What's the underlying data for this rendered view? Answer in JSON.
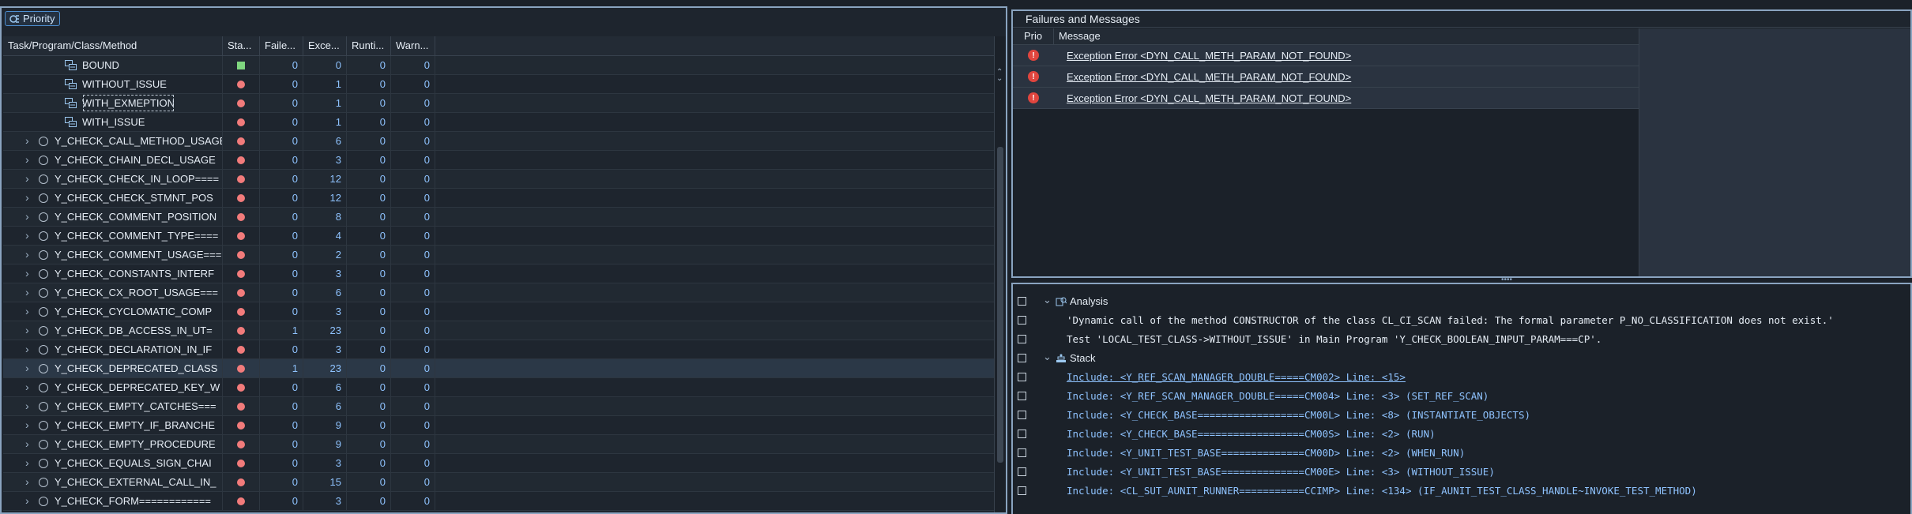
{
  "toolbar": {
    "priority_label": "Priority"
  },
  "task_table": {
    "columns": [
      "Task/Program/Class/Method",
      "Sta...",
      "Faile...",
      "Exce...",
      "Runti...",
      "Warn..."
    ],
    "rows": [
      {
        "name": "BOUND",
        "child": true,
        "status": "green",
        "failed": "0",
        "exceptions": "0",
        "runtime": "0",
        "warnings": "0"
      },
      {
        "name": "WITHOUT_ISSUE",
        "child": true,
        "status": "red",
        "failed": "0",
        "exceptions": "1",
        "runtime": "0",
        "warnings": "0"
      },
      {
        "name": "WITH_EXMEPTION",
        "child": true,
        "status": "red",
        "failed": "0",
        "exceptions": "1",
        "runtime": "0",
        "warnings": "0",
        "focused": true
      },
      {
        "name": "WITH_ISSUE",
        "child": true,
        "status": "red",
        "failed": "0",
        "exceptions": "1",
        "runtime": "0",
        "warnings": "0"
      },
      {
        "name": "Y_CHECK_CALL_METHOD_USAGE",
        "child": false,
        "status": "red",
        "failed": "0",
        "exceptions": "6",
        "runtime": "0",
        "warnings": "0"
      },
      {
        "name": "Y_CHECK_CHAIN_DECL_USAGE",
        "child": false,
        "status": "red",
        "failed": "0",
        "exceptions": "3",
        "runtime": "0",
        "warnings": "0"
      },
      {
        "name": "Y_CHECK_CHECK_IN_LOOP====",
        "child": false,
        "status": "red",
        "failed": "0",
        "exceptions": "12",
        "runtime": "0",
        "warnings": "0"
      },
      {
        "name": "Y_CHECK_CHECK_STMNT_POS",
        "child": false,
        "status": "red",
        "failed": "0",
        "exceptions": "12",
        "runtime": "0",
        "warnings": "0"
      },
      {
        "name": "Y_CHECK_COMMENT_POSITION",
        "child": false,
        "status": "red",
        "failed": "0",
        "exceptions": "8",
        "runtime": "0",
        "warnings": "0"
      },
      {
        "name": "Y_CHECK_COMMENT_TYPE====",
        "child": false,
        "status": "red",
        "failed": "0",
        "exceptions": "4",
        "runtime": "0",
        "warnings": "0"
      },
      {
        "name": "Y_CHECK_COMMENT_USAGE===",
        "child": false,
        "status": "red",
        "failed": "0",
        "exceptions": "2",
        "runtime": "0",
        "warnings": "0"
      },
      {
        "name": "Y_CHECK_CONSTANTS_INTERF",
        "child": false,
        "status": "red",
        "failed": "0",
        "exceptions": "3",
        "runtime": "0",
        "warnings": "0"
      },
      {
        "name": "Y_CHECK_CX_ROOT_USAGE===",
        "child": false,
        "status": "red",
        "failed": "0",
        "exceptions": "6",
        "runtime": "0",
        "warnings": "0"
      },
      {
        "name": "Y_CHECK_CYCLOMATIC_COMP",
        "child": false,
        "status": "red",
        "failed": "0",
        "exceptions": "3",
        "runtime": "0",
        "warnings": "0"
      },
      {
        "name": "Y_CHECK_DB_ACCESS_IN_UT=",
        "child": false,
        "status": "red",
        "failed": "1",
        "exceptions": "23",
        "runtime": "0",
        "warnings": "0"
      },
      {
        "name": "Y_CHECK_DECLARATION_IN_IF",
        "child": false,
        "status": "red",
        "failed": "0",
        "exceptions": "3",
        "runtime": "0",
        "warnings": "0"
      },
      {
        "name": "Y_CHECK_DEPRECATED_CLASS",
        "child": false,
        "status": "red",
        "failed": "1",
        "exceptions": "23",
        "runtime": "0",
        "warnings": "0",
        "selected": true
      },
      {
        "name": "Y_CHECK_DEPRECATED_KEY_W",
        "child": false,
        "status": "red",
        "failed": "0",
        "exceptions": "6",
        "runtime": "0",
        "warnings": "0"
      },
      {
        "name": "Y_CHECK_EMPTY_CATCHES===",
        "child": false,
        "status": "red",
        "failed": "0",
        "exceptions": "6",
        "runtime": "0",
        "warnings": "0"
      },
      {
        "name": "Y_CHECK_EMPTY_IF_BRANCHE",
        "child": false,
        "status": "red",
        "failed": "0",
        "exceptions": "9",
        "runtime": "0",
        "warnings": "0"
      },
      {
        "name": "Y_CHECK_EMPTY_PROCEDURE",
        "child": false,
        "status": "red",
        "failed": "0",
        "exceptions": "9",
        "runtime": "0",
        "warnings": "0"
      },
      {
        "name": "Y_CHECK_EQUALS_SIGN_CHAI",
        "child": false,
        "status": "red",
        "failed": "0",
        "exceptions": "3",
        "runtime": "0",
        "warnings": "0"
      },
      {
        "name": "Y_CHECK_EXTERNAL_CALL_IN_",
        "child": false,
        "status": "red",
        "failed": "0",
        "exceptions": "15",
        "runtime": "0",
        "warnings": "0"
      },
      {
        "name": "Y_CHECK_FORM============",
        "child": false,
        "status": "red",
        "failed": "0",
        "exceptions": "3",
        "runtime": "0",
        "warnings": "0"
      }
    ]
  },
  "failures": {
    "title": "Failures and Messages",
    "columns": [
      "Prio",
      "Message"
    ],
    "messages": [
      "Exception Error <DYN_CALL_METH_PARAM_NOT_FOUND>",
      "Exception Error <DYN_CALL_METH_PARAM_NOT_FOUND>",
      "Exception Error <DYN_CALL_METH_PARAM_NOT_FOUND>"
    ]
  },
  "details": {
    "analysis_label": "Analysis",
    "analysis_lines": [
      "'Dynamic call of the method CONSTRUCTOR of the class CL_CI_SCAN failed: The formal parameter P_NO_CLASSIFICATION does not exist.'",
      "Test 'LOCAL_TEST_CLASS->WITHOUT_ISSUE' in Main Program 'Y_CHECK_BOOLEAN_INPUT_PARAM===CP'."
    ],
    "stack_label": "Stack",
    "stack_lines": [
      "Include: <Y_REF_SCAN_MANAGER_DOUBLE=====CM002> Line: <15>",
      "Include: <Y_REF_SCAN_MANAGER_DOUBLE=====CM004> Line: <3> (SET_REF_SCAN)",
      "Include: <Y_CHECK_BASE==================CM00L> Line: <8> (INSTANTIATE_OBJECTS)",
      "Include: <Y_CHECK_BASE==================CM00S> Line: <2> (RUN)",
      "Include: <Y_UNIT_TEST_BASE==============CM00D> Line: <2> (WHEN_RUN)",
      "Include: <Y_UNIT_TEST_BASE==============CM00E> Line: <3> (WITHOUT_ISSUE)",
      "Include: <CL_SUT_AUNIT_RUNNER===========CCIMP> Line: <134> (IF_AUNIT_TEST_CLASS_HANDLE~INVOKE_TEST_METHOD)"
    ]
  },
  "colors": {
    "status_red": "#f27b7b",
    "status_green": "#7fd67f",
    "link_blue": "#8fc3ff",
    "error_red": "#e0453e"
  }
}
